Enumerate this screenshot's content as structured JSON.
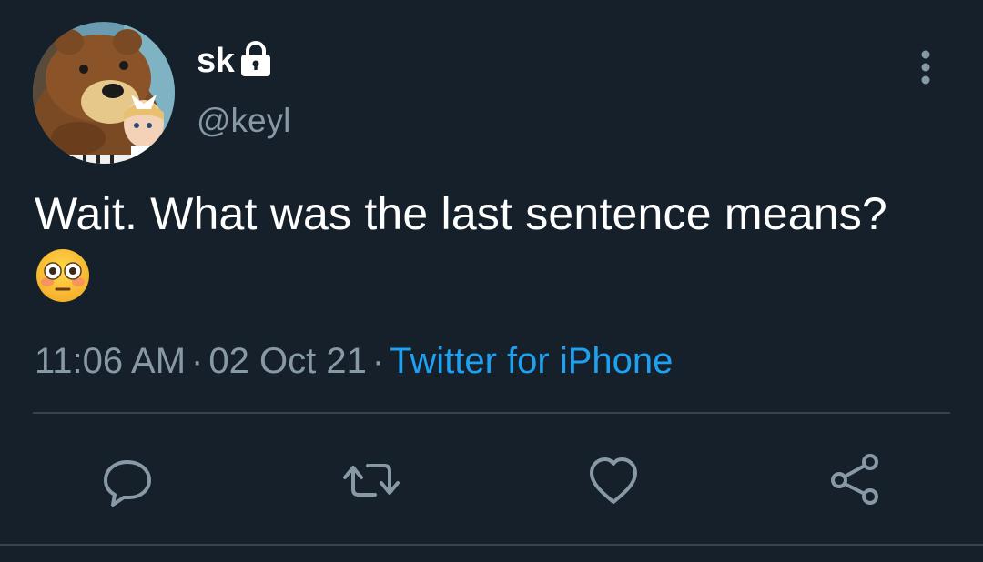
{
  "user": {
    "display_name": "sk",
    "handle": "@keyl",
    "avatar_icon": "avatar-bear-and-girl-icon",
    "protected_icon": "lock-icon"
  },
  "tweet": {
    "text": "Wait. What was the last sentence means?",
    "emoji": "flushed-face-icon",
    "time": "11:06 AM",
    "date": "02 Oct 21",
    "separator": "·",
    "source": "Twitter for iPhone"
  },
  "actions": [
    "reply-icon",
    "retweet-icon",
    "like-icon",
    "share-icon"
  ],
  "colors": {
    "background": "#15202b",
    "text": "#ffffff",
    "secondary_text": "#8899a6",
    "link": "#1da1f2",
    "divider": "#38444d",
    "icon": "#8899a6"
  }
}
